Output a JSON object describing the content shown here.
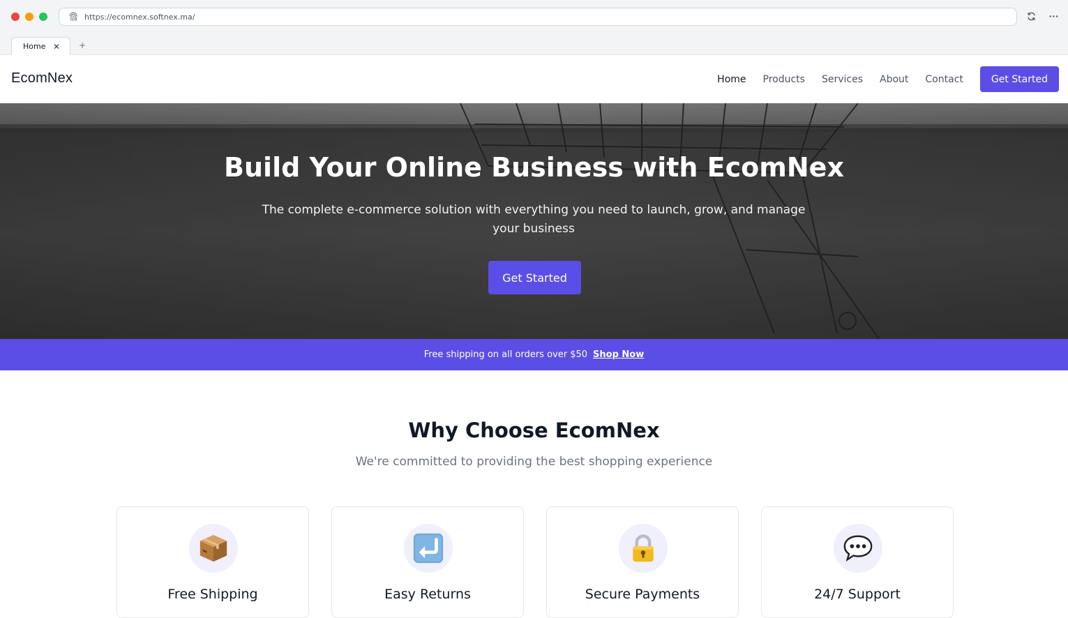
{
  "browser": {
    "url": "https://ecomnex.softnex.ma/",
    "tab_label": "Home",
    "new_tab": "+"
  },
  "nav": {
    "brand": "EcomNex",
    "items": [
      {
        "label": "Home",
        "active": true
      },
      {
        "label": "Products",
        "active": false
      },
      {
        "label": "Services",
        "active": false
      },
      {
        "label": "About",
        "active": false
      },
      {
        "label": "Contact",
        "active": false
      }
    ],
    "cta": "Get Started"
  },
  "hero": {
    "title": "Build Your Online Business with EcomNex",
    "subtitle": "The complete e-commerce solution with everything you need to launch, grow, and manage your business",
    "cta": "Get Started"
  },
  "promo": {
    "text": "Free shipping on all orders over $50",
    "link": "Shop Now"
  },
  "why": {
    "title": "Why Choose EcomNex",
    "subtitle": "We're committed to providing the best shopping experience",
    "features": [
      {
        "icon": "package-icon",
        "title": "Free Shipping"
      },
      {
        "icon": "return-arrow-icon",
        "title": "Easy Returns"
      },
      {
        "icon": "lock-icon",
        "title": "Secure Payments"
      },
      {
        "icon": "speech-bubble-icon",
        "title": "24/7 Support"
      }
    ]
  },
  "colors": {
    "accent": "#5b4ee6",
    "text_dark": "#111827",
    "text_muted": "#6b7280"
  }
}
